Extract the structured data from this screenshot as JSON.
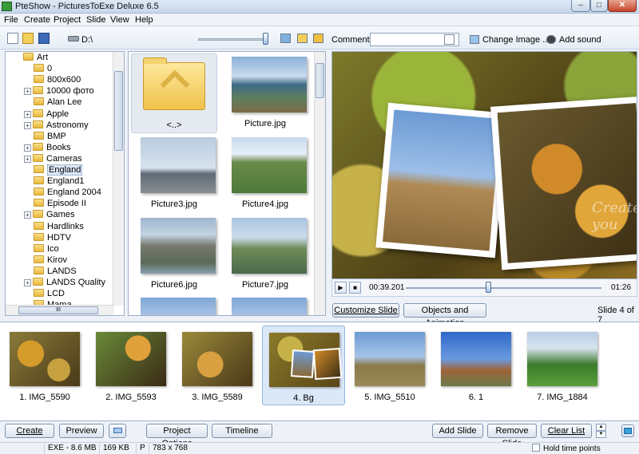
{
  "window": {
    "title": "PteShow - PicturesToExe Deluxe 6.5"
  },
  "menu": [
    "File",
    "Create",
    "Project",
    "Slide",
    "View",
    "Help"
  ],
  "toolbar": {
    "drive": "D:\\",
    "comment_label": "Comment",
    "comment_value": "",
    "change_image": "Change Image ...",
    "add_sound": "Add sound"
  },
  "tree": {
    "items": [
      {
        "label": "Art",
        "expandable": false,
        "open": true
      },
      {
        "label": "0",
        "expandable": false
      },
      {
        "label": "800x600",
        "expandable": false
      },
      {
        "label": "10000 фото",
        "expandable": true
      },
      {
        "label": "Alan Lee",
        "expandable": false
      },
      {
        "label": "Apple",
        "expandable": true
      },
      {
        "label": "Astronomy",
        "expandable": true
      },
      {
        "label": "BMP",
        "expandable": false
      },
      {
        "label": "Books",
        "expandable": true
      },
      {
        "label": "Cameras",
        "expandable": true
      },
      {
        "label": "England",
        "expandable": false,
        "selected": true
      },
      {
        "label": "England1",
        "expandable": false
      },
      {
        "label": "England 2004",
        "expandable": false
      },
      {
        "label": "Episode II",
        "expandable": false
      },
      {
        "label": "Games",
        "expandable": true
      },
      {
        "label": "Hardlinks",
        "expandable": false
      },
      {
        "label": "HDTV",
        "expandable": false
      },
      {
        "label": "Ico",
        "expandable": false
      },
      {
        "label": "Kirov",
        "expandable": false
      },
      {
        "label": "LANDS",
        "expandable": false
      },
      {
        "label": "LANDS Quality",
        "expandable": true
      },
      {
        "label": "LCD",
        "expandable": false
      },
      {
        "label": "Mama",
        "expandable": false
      }
    ],
    "hscroll_label": "III"
  },
  "files": [
    {
      "label": "<..>",
      "kind": "folder-up"
    },
    {
      "label": "Picture.jpg",
      "kind": "photo"
    },
    {
      "label": "Picture3.jpg",
      "kind": "photo"
    },
    {
      "label": "Picture4.jpg",
      "kind": "photo"
    },
    {
      "label": "Picture6.jpg",
      "kind": "photo"
    },
    {
      "label": "Picture7.jpg",
      "kind": "photo"
    }
  ],
  "preview": {
    "watermark": "Create you",
    "time_current": "00:39.201",
    "time_total": "01:26",
    "progress": 0.42
  },
  "slide_controls": {
    "customize": "Customize Slide",
    "objects": "Objects and Animation",
    "slide_of": "Slide 4 of 7"
  },
  "slides": [
    {
      "label": "1. IMG_5590",
      "selected": false
    },
    {
      "label": "2. IMG_5593",
      "selected": false
    },
    {
      "label": "3. IMG_5589",
      "selected": false
    },
    {
      "label": "4. Bg",
      "selected": true
    },
    {
      "label": "5. IMG_5510",
      "selected": false
    },
    {
      "label": "6. 1",
      "selected": false
    },
    {
      "label": "7. IMG_1884",
      "selected": false
    }
  ],
  "bottom_buttons": {
    "create": "Create",
    "preview": "Preview",
    "project_options": "Project Options",
    "timeline": "Timeline",
    "add_slide": "Add Slide",
    "remove_slide": "Remove Slide",
    "clear_list": "Clear List"
  },
  "status": {
    "exe": "EXE - 8.6 MB",
    "size": "169 KB",
    "flag": "P",
    "dims": "783 x 768",
    "hold_time": "Hold time points"
  },
  "colors": {
    "accent": "#3d6fb8",
    "selection": "#dbe8f8"
  }
}
